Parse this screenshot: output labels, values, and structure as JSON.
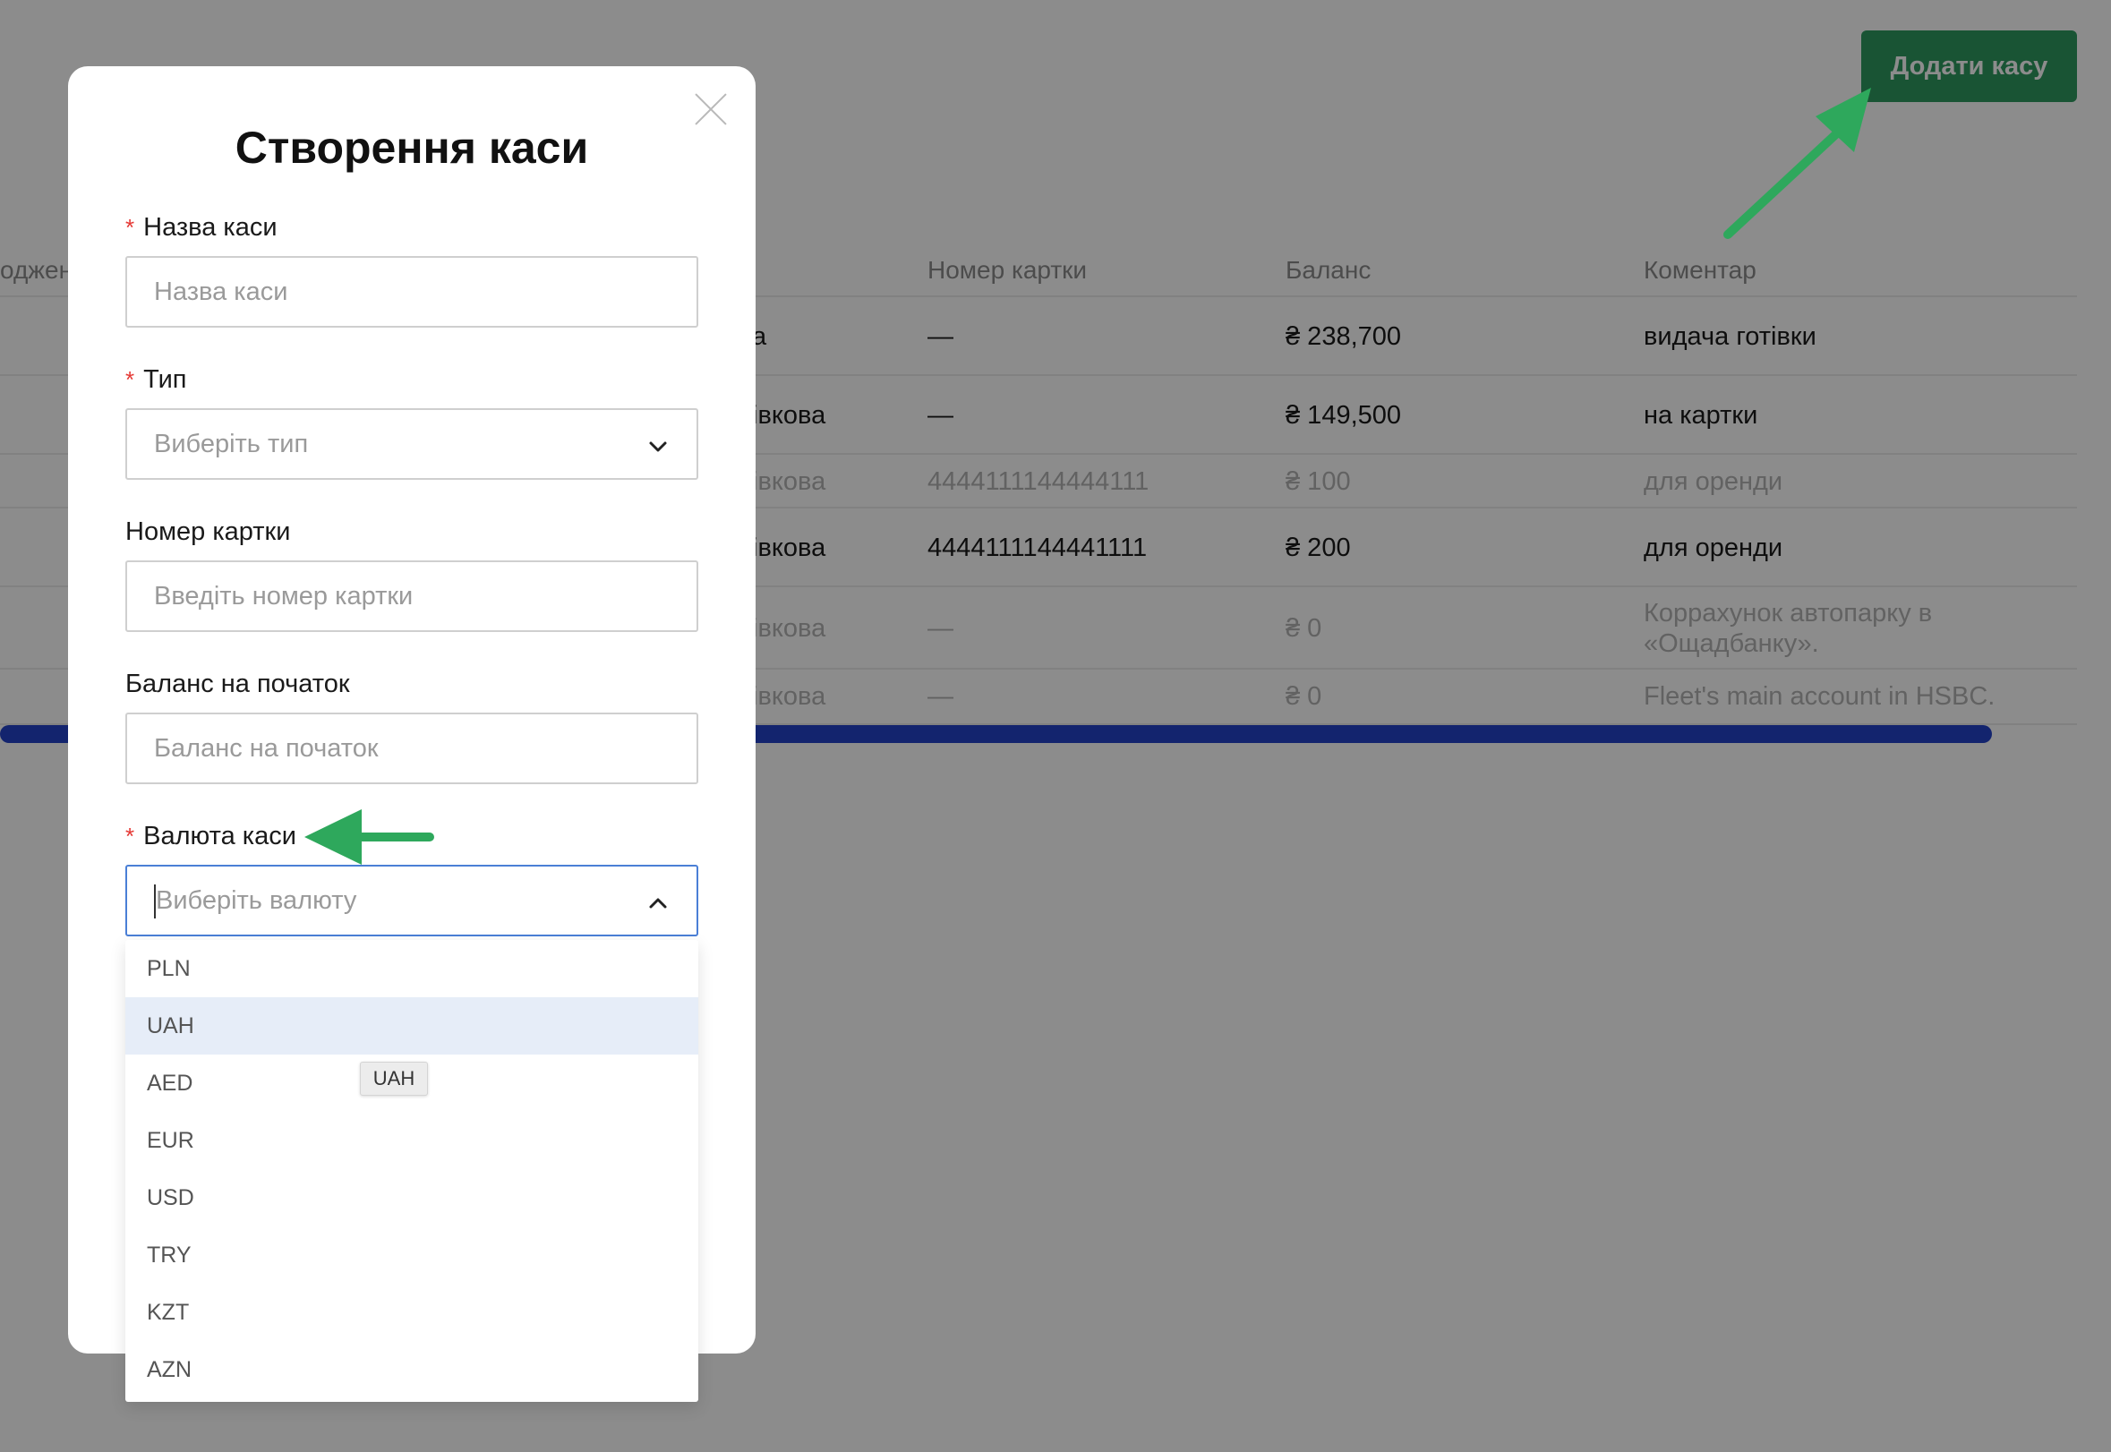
{
  "header": {
    "add_button": "Додати касу"
  },
  "table": {
    "columns": {
      "partial": "оджен",
      "card": "Номер картки",
      "balance": "Баланс",
      "comment": "Коментар"
    },
    "rows": [
      {
        "type": "а",
        "card": "—",
        "balance": "₴ 238,700",
        "comment": "видача готівки",
        "faded": false
      },
      {
        "type": "івкова",
        "card": "—",
        "balance": "₴ 149,500",
        "comment": "на картки",
        "faded": false
      },
      {
        "type": "івкова",
        "card": "4444111144444111",
        "balance": "₴ 100",
        "comment": "для оренди",
        "faded": true
      },
      {
        "type": "івкова",
        "card": "4444111144441111",
        "balance": "₴ 200",
        "comment": "для оренди",
        "faded": false
      },
      {
        "type": "івкова",
        "card": "—",
        "balance": "₴ 0",
        "comment": "Коррахунок автопарку в «Ощадбанку».",
        "faded": true
      },
      {
        "type": "івкова",
        "card": "—",
        "balance": "₴ 0",
        "comment": "Fleet's main account in HSBC.",
        "faded": true
      }
    ]
  },
  "modal": {
    "title": "Створення каси",
    "required_mark": "*",
    "fields": {
      "name": {
        "label": "Назва каси",
        "placeholder": "Назва каси"
      },
      "type": {
        "label": "Тип",
        "placeholder": "Виберіть тип"
      },
      "card": {
        "label": "Номер картки",
        "placeholder": "Введіть номер картки"
      },
      "balance": {
        "label": "Баланс на початок",
        "placeholder": "Баланс на початок"
      },
      "currency": {
        "label": "Валюта каси",
        "placeholder": "Виберіть валюту"
      }
    }
  },
  "currency_options": [
    "PLN",
    "UAH",
    "AED",
    "EUR",
    "USD",
    "TRY",
    "KZT",
    "AZN"
  ],
  "hovered_option": "UAH",
  "tooltip": "UAH",
  "colors": {
    "primary_button": "#2f9960",
    "annotation_arrow": "#2ea85c",
    "required": "#e53935",
    "scrollbar": "#2442c8",
    "focus_border": "#4a7fd6"
  },
  "icons": {
    "close": "close-icon",
    "select_closed": "chevron-down-icon",
    "select_open": "chevron-up-icon"
  }
}
